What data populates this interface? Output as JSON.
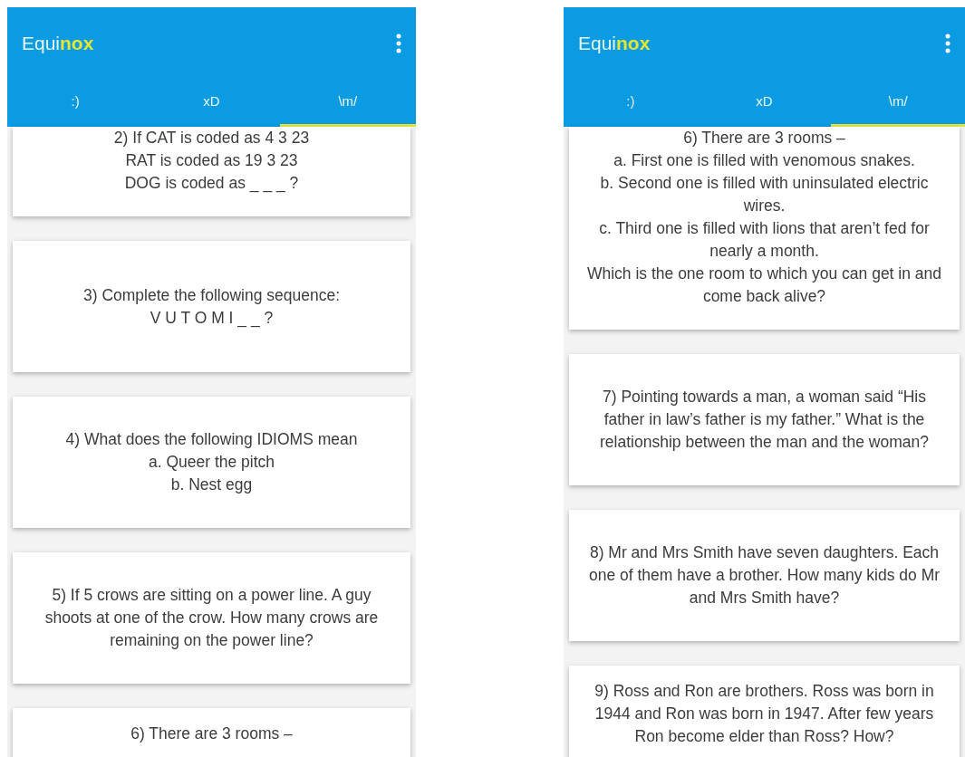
{
  "screens": [
    {
      "app_title": "Equi**nox**",
      "tabs": [
        {
          "label": ":)",
          "selected": false
        },
        {
          "label": "xD",
          "selected": false
        },
        {
          "label": "\\m/",
          "selected": true
        }
      ],
      "cards": [
        {
          "lines": [
            "2) If CAT is coded as 4 3 23",
            "RAT is coded as 19 3 23",
            "DOG is coded as _ _ _ ?"
          ]
        },
        {
          "lines": [
            "3) Complete the following sequence:",
            "V U T O M I _ _ ?"
          ]
        },
        {
          "lines": [
            "4) What does the following IDIOMS mean",
            "a. Queer the pitch",
            "b. Nest egg"
          ]
        },
        {
          "lines": [
            "5) If 5 crows are sitting on a power line. A guy shoots at one of the crow. How many crows are remaining on the power line?"
          ]
        },
        {
          "lines": [
            "6) There are 3 rooms –"
          ]
        }
      ]
    },
    {
      "app_title": "Equi**nox**",
      "tabs": [
        {
          "label": ":)",
          "selected": false
        },
        {
          "label": "xD",
          "selected": false
        },
        {
          "label": "\\m/",
          "selected": true
        }
      ],
      "cards": [
        {
          "lines": [
            "6) There are 3 rooms –",
            "a. First one is filled with venomous snakes.",
            "b. Second one is filled with uninsulated electric wires.",
            "c. Third one is filled with lions that aren’t fed for nearly a month.",
            "Which is the one room to which you can get in and come back alive?"
          ]
        },
        {
          "lines": [
            "7) Pointing towards a man, a woman said “His father in law’s father is my father.” What is the relationship between the man and the woman?"
          ]
        },
        {
          "lines": [
            "8) Mr and Mrs Smith have seven daughters. Each one of them have a brother. How many kids do Mr and Mrs Smith have?"
          ]
        },
        {
          "lines": [
            "9) Ross and Ron are brothers. Ross was born in 1944 and Ron was born in 1947. After few years Ron become elder than Ross? How?"
          ]
        }
      ]
    }
  ]
}
